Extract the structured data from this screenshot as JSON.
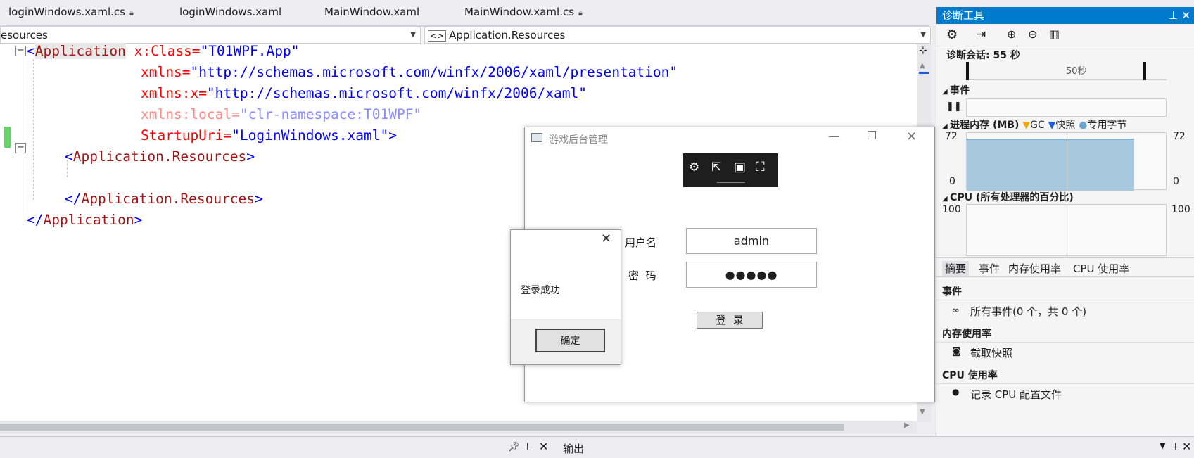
{
  "tabs": [
    {
      "label": "loginWindows.xaml.cs",
      "locked": true
    },
    {
      "label": "loginWindows.xaml",
      "locked": false
    },
    {
      "label": "MainWindow.xaml",
      "locked": false
    },
    {
      "label": "MainWindow.xaml.cs",
      "locked": true
    }
  ],
  "nav": {
    "left_combo": "esources",
    "right_combo": "Application.Resources"
  },
  "code": {
    "l1_open": "<",
    "l1_tag": "Application",
    "l1_attr": " x:Class=",
    "l1_val": "\"T01WPF.App\"",
    "l2_attr": "xmlns=",
    "l2_val": "\"http://schemas.microsoft.com/winfx/2006/xaml/presentation\"",
    "l3_attr": "xmlns:x=",
    "l3_val": "\"http://schemas.microsoft.com/winfx/2006/xaml\"",
    "l4_attr": "xmlns:local=",
    "l4_val": "\"clr-namespace:T01WPF\"",
    "l5_attr": "StartupUri=",
    "l5_val": "\"LoginWindows.xaml\"",
    "l5_close": ">",
    "l6_open": "<",
    "l6_tag": "Application.Resources",
    "l6_close": ">",
    "l8_open": "</",
    "l8_tag": "Application.Resources",
    "l8_close": ">",
    "l9_open": "</",
    "l9_tag": "Application",
    "l9_close": ">"
  },
  "diagnostics": {
    "title": "诊断工具",
    "session": "诊断会话: 55 秒",
    "timeline_label": "50秒",
    "events_section": "事件",
    "memory_section": "进程内存 (MB)",
    "legend_gc": "GC",
    "legend_snapshot": "快照",
    "legend_private": "专用字节",
    "mem_max_left": "72",
    "mem_min_left": "0",
    "mem_max_right": "72",
    "mem_min_right": "0",
    "cpu_section": "CPU (所有处理器的百分比)",
    "cpu_max_left": "100",
    "cpu_max_right": "100",
    "subtabs": [
      "摘要",
      "事件",
      "内存使用率",
      "CPU 使用率"
    ],
    "events_heading": "事件",
    "all_events": "所有事件(0 个，共 0 个)",
    "mem_heading": "内存使用率",
    "take_snapshot": "截取快照",
    "cpu_heading": "CPU 使用率",
    "record_cpu": "记录 CPU 配置文件",
    "accent": "#007acc",
    "mem_fill": "#a8c8e0"
  },
  "bottom": {
    "output_label": "输出"
  },
  "app_window": {
    "title": "游戏后台管理",
    "username_label": "用户名",
    "username_value": "admin",
    "password_label": "密  码",
    "password_value": "●●●●●",
    "login_button": "登  录"
  },
  "msgbox": {
    "text": "登录成功",
    "ok": "确定"
  }
}
